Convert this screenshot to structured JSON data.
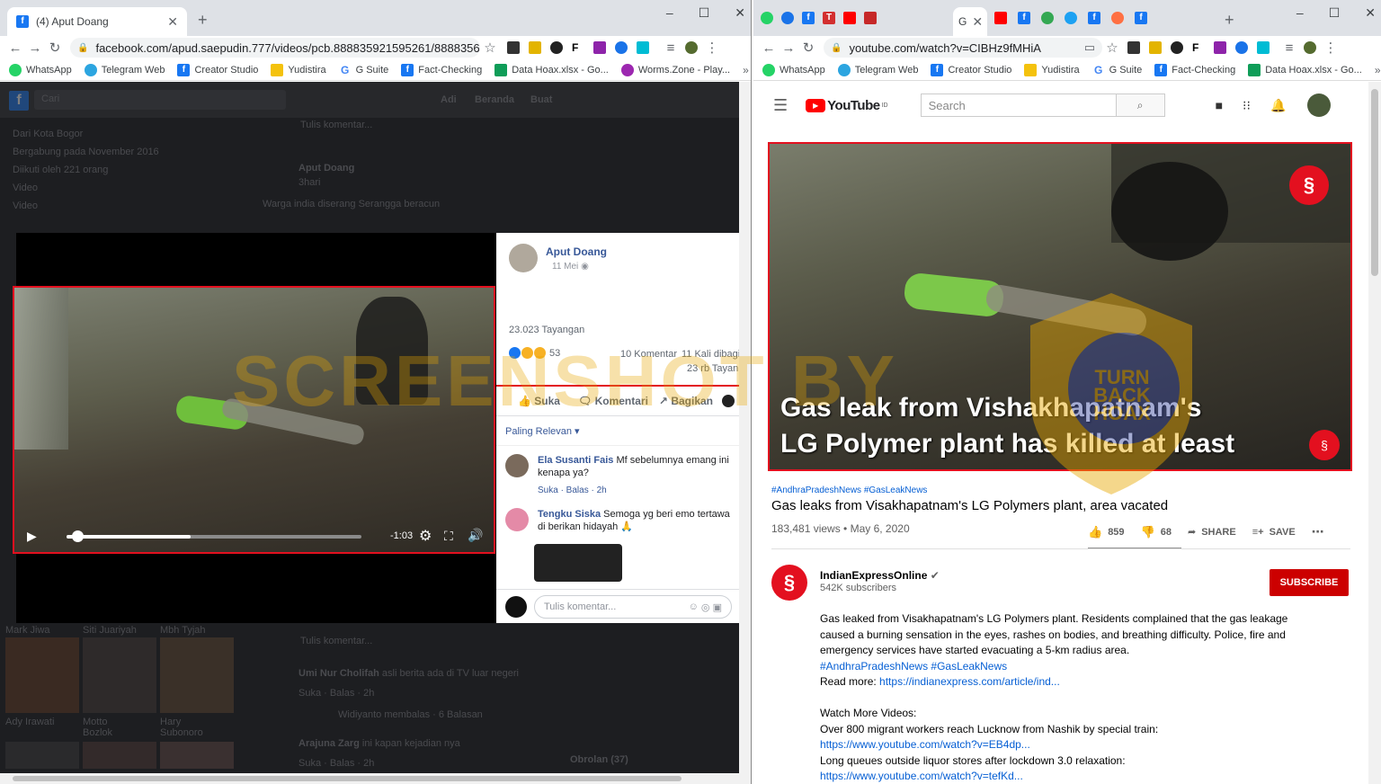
{
  "left": {
    "tab_title": "(4) Aput Doang",
    "url": "facebook.com/apud.saepudin.777/videos/pcb.888835921595261/8888356...",
    "bookmarks": [
      "WhatsApp",
      "Telegram Web",
      "Creator Studio",
      "Yudistira",
      "G Suite",
      "Fact-Checking",
      "Data Hoax.xlsx - Go...",
      "Worms.Zone - Play..."
    ],
    "fb_search_placeholder": "Cari",
    "fb_nav": [
      "Adi",
      "Beranda",
      "Buat"
    ],
    "bg_intro": [
      "Dari Kota Bogor",
      "Bergabung pada November 2016",
      "Diikuti oleh 221 orang",
      "Video",
      "Video"
    ],
    "bg_post_author": "Aput Doang",
    "bg_post_time": "3hari",
    "bg_post_text": "Warga india diserang Serangga beracun",
    "bg_write_comment": "Tulis komentar...",
    "video_time": "-1:03",
    "video_progress": 0.42,
    "panel": {
      "author": "Aput Doang",
      "date": "11 Mei",
      "views": "23.023 Tayangan",
      "reaction_count": "53",
      "comments": "10 Komentar",
      "shares": "11 Kali dibagi",
      "views2": "23 rb Tayan",
      "actions": [
        "Suka",
        "Komentari",
        "Bagikan"
      ],
      "sort": "Paling Relevan",
      "comment_list": [
        {
          "name": "Ela Susanti Fais",
          "text": "Mf sebelumnya emang ini kenapa ya?",
          "meta": "Suka · Balas · 2h"
        },
        {
          "name": "Tengku Siska",
          "text": "Semoga yg beri emo tertawa di berikan hidayah 🙏",
          "meta": ""
        }
      ],
      "write_placeholder": "Tulis komentar..."
    },
    "bg_lower": [
      {
        "name": "Umi Nur Cholifah",
        "text": "asli berita ada di TV luar negeri",
        "meta": "Suka · Balas · 2h"
      },
      {
        "name": "Widiyanto",
        "text": "membalas · 6 Balasan",
        "meta": ""
      },
      {
        "name": "Arajuna Zarg",
        "text": "ini kapan kejadian nya",
        "meta": "Suka · Balas · 2h"
      }
    ],
    "friends": [
      "Mark Jiwa",
      "Siti Juariyah",
      "Mbh Tyjah",
      "Ady Irawati",
      "Motto Bozlok",
      "Hary Subonoro"
    ],
    "chat": "Obrolan (37)"
  },
  "right": {
    "tab_title": "G",
    "url": "youtube.com/watch?v=CIBHz9fMHiA",
    "bookmarks": [
      "WhatsApp",
      "Telegram Web",
      "Creator Studio",
      "Yudistira",
      "G Suite",
      "Fact-Checking",
      "Data Hoax.xlsx - Go..."
    ],
    "logo_text": "YouTube",
    "logo_region": "ID",
    "search_placeholder": "Search",
    "overlay_line1": "Gas leak from Vishakhapatnam's",
    "overlay_line2": "LG Polymer plant has killed at least",
    "hashtags": "#AndhraPradeshNews #GasLeakNews",
    "video_title": "Gas leaks from Visakhapatnam's LG Polymers plant, area vacated",
    "views_date": "183,481 views • May 6, 2020",
    "likes": "859",
    "dislikes": "68",
    "share": "SHARE",
    "save": "SAVE",
    "channel": "IndianExpressOnline",
    "subscribers": "542K subscribers",
    "subscribe": "SUBSCRIBE",
    "desc": {
      "p1": "Gas leaked from Visakhapatnam's LG Polymers plant. Residents complained that the gas leakage",
      "p2": "caused a burning sensation in the eyes, rashes on bodies, and breathing difficulty. Police, fire and",
      "p3": "emergency services have started evacuating a 5-km radius area.",
      "tags": "#AndhraPradeshNews #GasLeakNews",
      "readmore_label": "Read more:",
      "readmore_link": "https://indianexpress.com/article/ind...",
      "watch": "Watch More Videos:",
      "w1": "Over 800 migrant workers reach Lucknow from Nashik by special train:",
      "w1_link": "https://www.youtube.com/watch?v=EB4dp...",
      "w2": "Long queues outside liquor stores after lockdown 3.0 relaxation:",
      "w2_link": "https://www.youtube.com/watch?v=tefKd..."
    }
  },
  "watermark": {
    "line1": "SCREENSHOT BY",
    "badge": "TURN BACK HOAX",
    "badge_ring": "MASYARAKAT ANTI FITNAH INDONESIA · MAFINDO"
  },
  "colors": {
    "red_box": "#e3101f",
    "fb_blue": "#1877f2",
    "yt_red": "#ff0000",
    "subscribe": "#cc0000",
    "watermark": "#e8a700"
  }
}
